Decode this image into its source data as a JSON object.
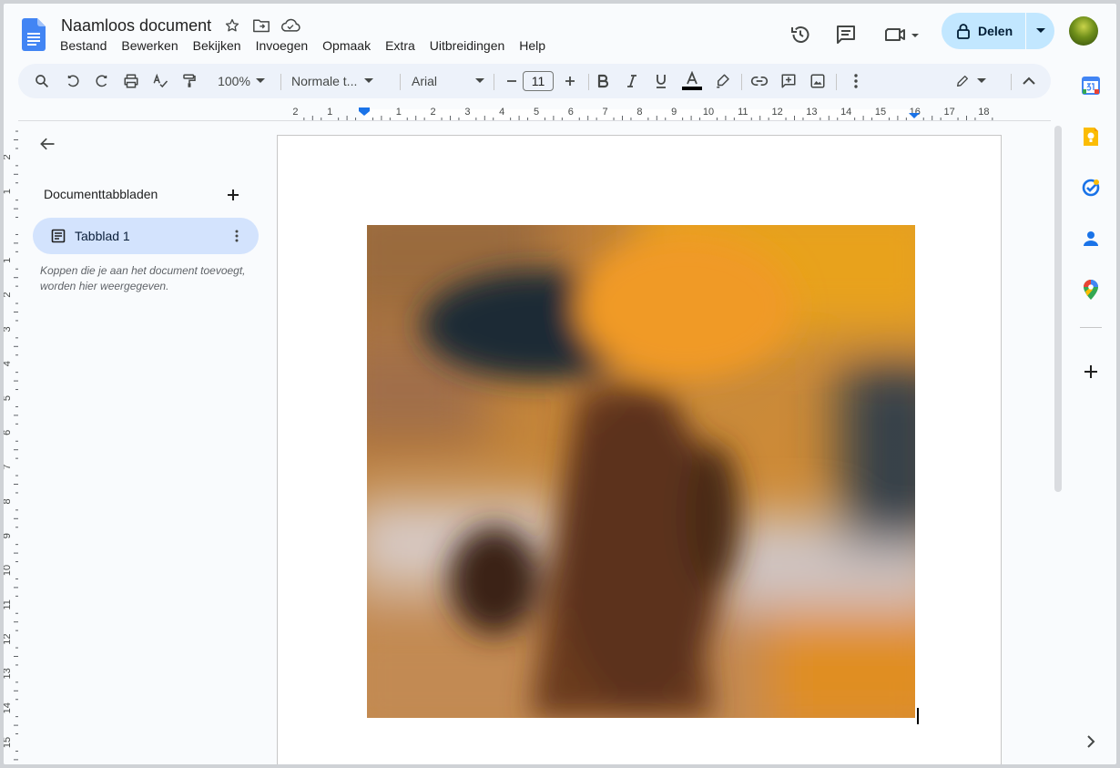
{
  "doc": {
    "title": "Naamloos document"
  },
  "menu": [
    "Bestand",
    "Bewerken",
    "Bekijken",
    "Invoegen",
    "Opmaak",
    "Extra",
    "Uitbreidingen",
    "Help"
  ],
  "share": {
    "label": "Delen"
  },
  "toolbar": {
    "zoom": "100%",
    "style": "Normale t...",
    "font": "Arial",
    "font_size": "11"
  },
  "sidebar": {
    "heading": "Documenttabbladen",
    "tab_label": "Tabblad 1",
    "note": "Koppen die je aan het document toevoegt, worden hier weergegeven."
  },
  "ruler": {
    "h_labels": [
      "2",
      "1",
      "1",
      "2",
      "3",
      "4",
      "5",
      "6",
      "7",
      "8",
      "9",
      "10",
      "11",
      "12",
      "13",
      "14",
      "15",
      "16",
      "17",
      "18"
    ],
    "v_labels": [
      "2",
      "1",
      "1",
      "2",
      "3",
      "4",
      "5",
      "6",
      "7",
      "8",
      "9",
      "10",
      "11",
      "12",
      "13",
      "14",
      "15"
    ]
  },
  "colors": {
    "accent": "#0b57d0",
    "share_bg": "#c2e7ff",
    "tab_bg": "#d3e3fd",
    "text_color_bar": "#000000"
  },
  "icons": {
    "header": [
      "star-icon",
      "move-to-folder-icon",
      "cloud-saved-icon",
      "history-icon",
      "comments-icon",
      "meet-icon",
      "lock-icon"
    ],
    "right_panel": [
      "calendar-icon",
      "keep-icon",
      "tasks-icon",
      "contacts-icon",
      "maps-icon",
      "add-icon",
      "expand-icon"
    ]
  }
}
